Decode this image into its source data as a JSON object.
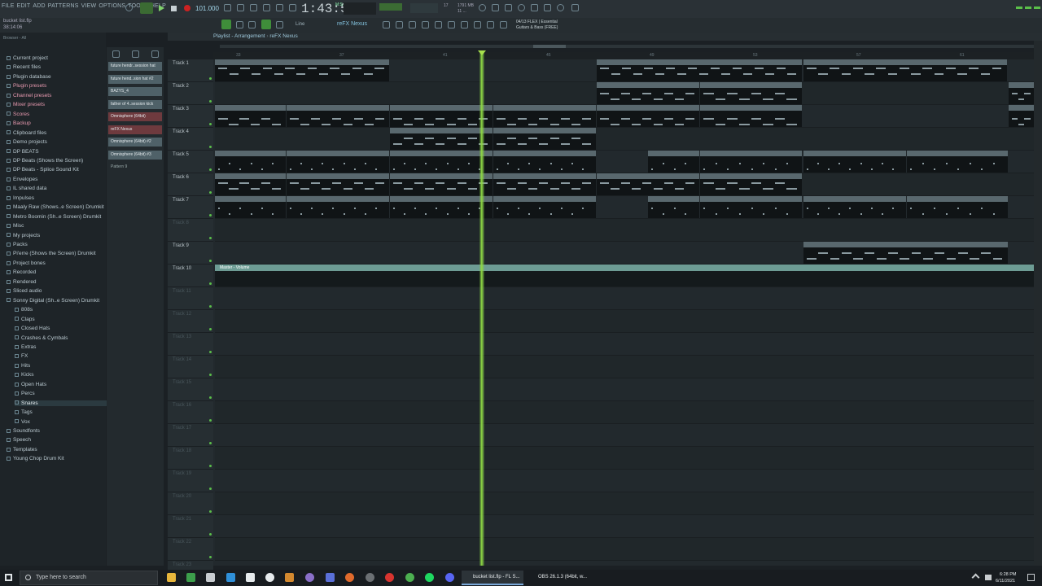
{
  "menu": [
    "FILE",
    "EDIT",
    "ADD",
    "PATTERNS",
    "VIEW",
    "OPTIONS",
    "TOOLS",
    "HELP"
  ],
  "project": {
    "file": "bucket list.flp",
    "time": "38:14:06"
  },
  "transport": {
    "bpm": "101.000",
    "clock": "1:43:57",
    "clock_sub": "M:S:CS",
    "cpu": "17",
    "ram": "1791 MB",
    "ram_sub": "11 ..."
  },
  "hint": {
    "line1": "04/13  FLEX | Essential",
    "line2": "Guitars & Bass (FREE)"
  },
  "toolbar": {
    "mode": "Line",
    "pattern": "reFX Nexus"
  },
  "browser": {
    "header": "Browser - All",
    "items": [
      {
        "label": "Current project",
        "pink": false,
        "sub": false,
        "selected": false
      },
      {
        "label": "Recent files",
        "pink": false,
        "sub": false,
        "selected": false
      },
      {
        "label": "Plugin database",
        "pink": false,
        "sub": false,
        "selected": false
      },
      {
        "label": "Plugin presets",
        "pink": true,
        "sub": false,
        "selected": false
      },
      {
        "label": "Channel presets",
        "pink": true,
        "sub": false,
        "selected": false
      },
      {
        "label": "Mixer presets",
        "pink": true,
        "sub": false,
        "selected": false
      },
      {
        "label": "Scores",
        "pink": true,
        "sub": false,
        "selected": false
      },
      {
        "label": "Backup",
        "pink": true,
        "sub": false,
        "selected": false
      },
      {
        "label": "Clipboard files",
        "pink": false,
        "sub": false,
        "selected": false
      },
      {
        "label": "Demo projects",
        "pink": false,
        "sub": false,
        "selected": false
      },
      {
        "label": "DP BEATS",
        "pink": false,
        "sub": false,
        "selected": false
      },
      {
        "label": "DP Beats (Shows the Screen)",
        "pink": false,
        "sub": false,
        "selected": false
      },
      {
        "label": "DP Beats - Splice Sound Kit",
        "pink": false,
        "sub": false,
        "selected": false
      },
      {
        "label": "Envelopes",
        "pink": false,
        "sub": false,
        "selected": false
      },
      {
        "label": "IL shared data",
        "pink": false,
        "sub": false,
        "selected": false
      },
      {
        "label": "Impulses",
        "pink": false,
        "sub": false,
        "selected": false
      },
      {
        "label": "Maaly Raw (Shows..e Screen) Drumkit",
        "pink": false,
        "sub": false,
        "selected": false
      },
      {
        "label": "Metro Boomin (Sh..e Screen) Drumkit",
        "pink": false,
        "sub": false,
        "selected": false
      },
      {
        "label": "Misc",
        "pink": false,
        "sub": false,
        "selected": false
      },
      {
        "label": "My projects",
        "pink": false,
        "sub": false,
        "selected": false
      },
      {
        "label": "Packs",
        "pink": false,
        "sub": false,
        "selected": false
      },
      {
        "label": "Pi'erre (Shows the Screen) Drumkit",
        "pink": false,
        "sub": false,
        "selected": false
      },
      {
        "label": "Project bones",
        "pink": false,
        "sub": false,
        "selected": false
      },
      {
        "label": "Recorded",
        "pink": false,
        "sub": false,
        "selected": false
      },
      {
        "label": "Rendered",
        "pink": false,
        "sub": false,
        "selected": false
      },
      {
        "label": "Sliced audio",
        "pink": false,
        "sub": false,
        "selected": false
      },
      {
        "label": "Sonny Digital (Sh..e Screen) Drumkit",
        "pink": false,
        "sub": false,
        "selected": false
      },
      {
        "label": "808s",
        "pink": false,
        "sub": true,
        "selected": false
      },
      {
        "label": "Claps",
        "pink": false,
        "sub": true,
        "selected": false
      },
      {
        "label": "Closed Hats",
        "pink": false,
        "sub": true,
        "selected": false
      },
      {
        "label": "Crashes & Cymbals",
        "pink": false,
        "sub": true,
        "selected": false
      },
      {
        "label": "Extras",
        "pink": false,
        "sub": true,
        "selected": false
      },
      {
        "label": "FX",
        "pink": false,
        "sub": true,
        "selected": false
      },
      {
        "label": "Hits",
        "pink": false,
        "sub": true,
        "selected": false
      },
      {
        "label": "Kicks",
        "pink": false,
        "sub": true,
        "selected": false
      },
      {
        "label": "Open Hats",
        "pink": false,
        "sub": true,
        "selected": false
      },
      {
        "label": "Percs",
        "pink": false,
        "sub": true,
        "selected": false
      },
      {
        "label": "Snares",
        "pink": false,
        "sub": true,
        "selected": true
      },
      {
        "label": "Tags",
        "pink": false,
        "sub": true,
        "selected": false
      },
      {
        "label": "Vox",
        "pink": false,
        "sub": true,
        "selected": false
      },
      {
        "label": "Soundfonts",
        "pink": false,
        "sub": false,
        "selected": false
      },
      {
        "label": "Speech",
        "pink": false,
        "sub": false,
        "selected": false
      },
      {
        "label": "Templates",
        "pink": false,
        "sub": false,
        "selected": false
      },
      {
        "label": "Young Chop Drum Kit",
        "pink": false,
        "sub": false,
        "selected": false
      }
    ]
  },
  "picker": [
    {
      "label": "future hendr..session hat",
      "red": false
    },
    {
      "label": "future hend..sion hat #2",
      "red": false
    },
    {
      "label": "BAZYS_4",
      "red": false
    },
    {
      "label": "father of 4..session kick",
      "red": false
    },
    {
      "label": "Omnisphere (64bit)",
      "red": true
    },
    {
      "label": "reFX Nexus",
      "red": true
    },
    {
      "label": "Omnisphere (64bit) #2",
      "red": false
    },
    {
      "label": "Omnisphere (64bit) #3",
      "red": false
    },
    {
      "label": "Pattern 9",
      "red": false
    }
  ],
  "playlist": {
    "title": "Playlist - Arrangement",
    "pattern": "reFX Nexus",
    "ruler": [
      "33",
      "37",
      "41",
      "45",
      "49",
      "53",
      "57",
      "61"
    ],
    "tracks": [
      "Track 1",
      "Track 2",
      "Track 3",
      "Track 4",
      "Track 5",
      "Track 6",
      "Track 7",
      "Track 8",
      "Track 9",
      "Track 10",
      "Track 11",
      "Track 12",
      "Track 13",
      "Track 14",
      "Track 15",
      "Track 16",
      "Track 17",
      "Track 18",
      "Track 19",
      "Track 20",
      "Track 21",
      "Track 22",
      "Track 23"
    ],
    "automation_label": "Master - Volume",
    "clip_names": {
      "nexus": "reFX Nexus",
      "omni": "Omnisphere (64bit)",
      "omni2": "Omnisphere (64bit) #2",
      "omni3": "Omnisphere (64bit) #3",
      "omni_short": "Omni..",
      "hat": "future hendrix session hat",
      "hat_short": "future hendr.. essio hat",
      "kick": "father of 4 pains red room session kick",
      "kick_short": "father of 4 pains.. room session kick",
      "bazys": "BAZYS_4",
      "pattern9": "Pattern 9"
    }
  },
  "taskbar": {
    "search_placeholder": "Type here to search",
    "fl_task": "bucket list.flp - FL S...",
    "obs_task": "OBS 26.1.3 (64bit, w...",
    "time": "6:28 PM",
    "date": "6/11/2021"
  },
  "colors": {
    "accent": "#8fd845",
    "clip": "#59686e",
    "automation": "#6d9c94"
  }
}
